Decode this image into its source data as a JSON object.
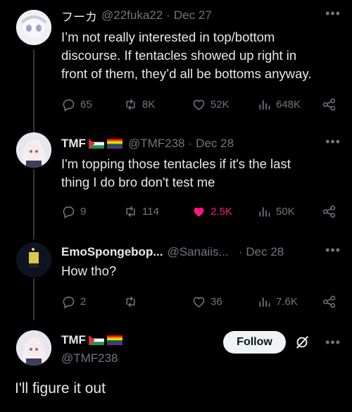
{
  "tweets": [
    {
      "name": "フーカ",
      "handle": "@22fuka22",
      "date": "Dec 27",
      "text_lines": [
        "I’m not really interested in top/bottom",
        "discourse. If tentacles showed up right in",
        "front of them, they’d all be bottoms anyway."
      ],
      "replies": "65",
      "retweets": "8K",
      "likes": "52K",
      "views": "648K"
    },
    {
      "name": "TMF",
      "handle": "@TMF238",
      "date": "Dec 28",
      "text_lines": [
        "I'm topping those tentacles if it's the last",
        "thing I do bro don't test me"
      ],
      "replies": "9",
      "retweets": "114",
      "likes": "2.5K",
      "views": "50K",
      "liked_color": "#f91880"
    },
    {
      "name": "EmoSpongebop...",
      "handle": "@Sanaiis...",
      "date": "Dec 28",
      "text_lines": [
        "How tho?"
      ],
      "replies": "2",
      "retweets": "",
      "likes": "36",
      "views": "7.6K"
    }
  ],
  "focused": {
    "name": "TMF",
    "handle": "@TMF238",
    "follow_label": "Follow",
    "reply_text": "I'll figure it out"
  },
  "more_label": "•••",
  "colors": {
    "accent_like": "#f91880",
    "muted": "#71767b",
    "text": "#e7e9ea"
  }
}
